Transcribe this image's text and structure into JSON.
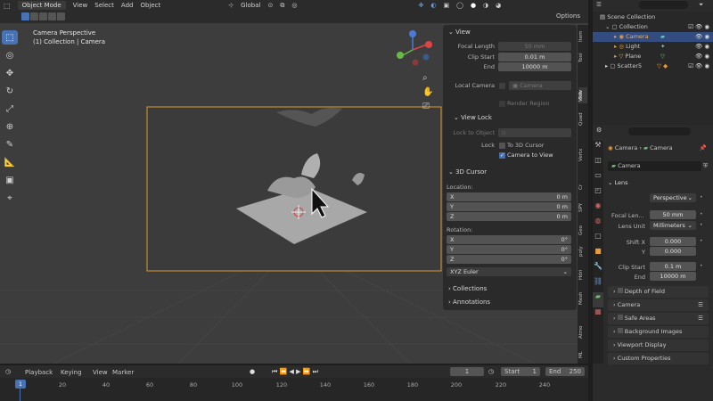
{
  "header": {
    "mode": "Object Mode",
    "menus": [
      "View",
      "Select",
      "Add",
      "Object"
    ],
    "orientation": "Global",
    "options_label": "Options"
  },
  "viewport": {
    "camera_title": "Camera Perspective",
    "camera_subtitle": "(1) Collection | Camera"
  },
  "npanel": {
    "view_header": "View",
    "focal_length_label": "Focal Length",
    "focal_length_value": "50 mm",
    "clip_start_label": "Clip Start",
    "clip_start_value": "0.01 m",
    "clip_end_label": "End",
    "clip_end_value": "10000 m",
    "local_camera_label": "Local Camera",
    "local_camera_value": "Camera",
    "render_region_label": "Render Region",
    "view_lock_header": "View Lock",
    "lock_to_object_label": "Lock to Object",
    "lock_label": "Lock",
    "to_3d_cursor_label": "To 3D Cursor",
    "camera_to_view_label": "Camera to View",
    "cursor_header": "3D Cursor",
    "location_label": "Location:",
    "loc_x_label": "X",
    "loc_x_value": "0 m",
    "loc_y_label": "Y",
    "loc_y_value": "0 m",
    "loc_z_label": "Z",
    "loc_z_value": "0 m",
    "rotation_label": "Rotation:",
    "rot_x_label": "X",
    "rot_x_value": "0°",
    "rot_y_label": "Y",
    "rot_y_value": "0°",
    "rot_z_label": "Z",
    "rot_z_value": "0°",
    "rotation_mode": "XYZ Euler",
    "collections_label": "Collections",
    "annotations_label": "Annotations"
  },
  "side_tabs": [
    "Item",
    "Tool",
    "View",
    "P.P",
    "Quad",
    "Vertx",
    "Cr",
    "SPY",
    "Geo",
    "poly",
    "Hdri",
    "Mesh",
    "Atmo",
    "ML"
  ],
  "outliner": {
    "scene_collection": "Scene Collection",
    "collection": "Collection",
    "items": [
      "Camera",
      "Light",
      "Plane"
    ],
    "scatter": "Scatter5"
  },
  "properties": {
    "breadcrumb_object": "Camera",
    "breadcrumb_data": "Camera",
    "data_name": "Camera",
    "lens_header": "Lens",
    "type_label": "Type",
    "type_value": "Perspective",
    "focal_label": "Focal Len...",
    "focal_value": "50 mm",
    "lens_unit_label": "Lens Unit",
    "lens_unit_value": "Millimeters",
    "shift_x_label": "Shift X",
    "shift_x_value": "0.000",
    "shift_y_label": "Y",
    "shift_y_value": "0.000",
    "clip_start_label": "Clip Start",
    "clip_start_value": "0.1 m",
    "clip_end_label": "End",
    "clip_end_value": "10000 m",
    "panels": [
      "Depth of Field",
      "Camera",
      "Safe Areas",
      "Background Images",
      "Viewport Display",
      "Custom Properties"
    ]
  },
  "timeline": {
    "menus": [
      "Playback",
      "Keying",
      "View",
      "Marker"
    ],
    "current_frame": "1",
    "start_label": "Start",
    "start_value": "1",
    "end_label": "End",
    "end_value": "250",
    "playhead": "1",
    "ticks": [
      "20",
      "40",
      "60",
      "80",
      "100",
      "120",
      "140",
      "160",
      "180",
      "200",
      "220",
      "240"
    ]
  },
  "colors": {
    "accent": "#4772b3",
    "camera_frame": "#d99b2e"
  }
}
